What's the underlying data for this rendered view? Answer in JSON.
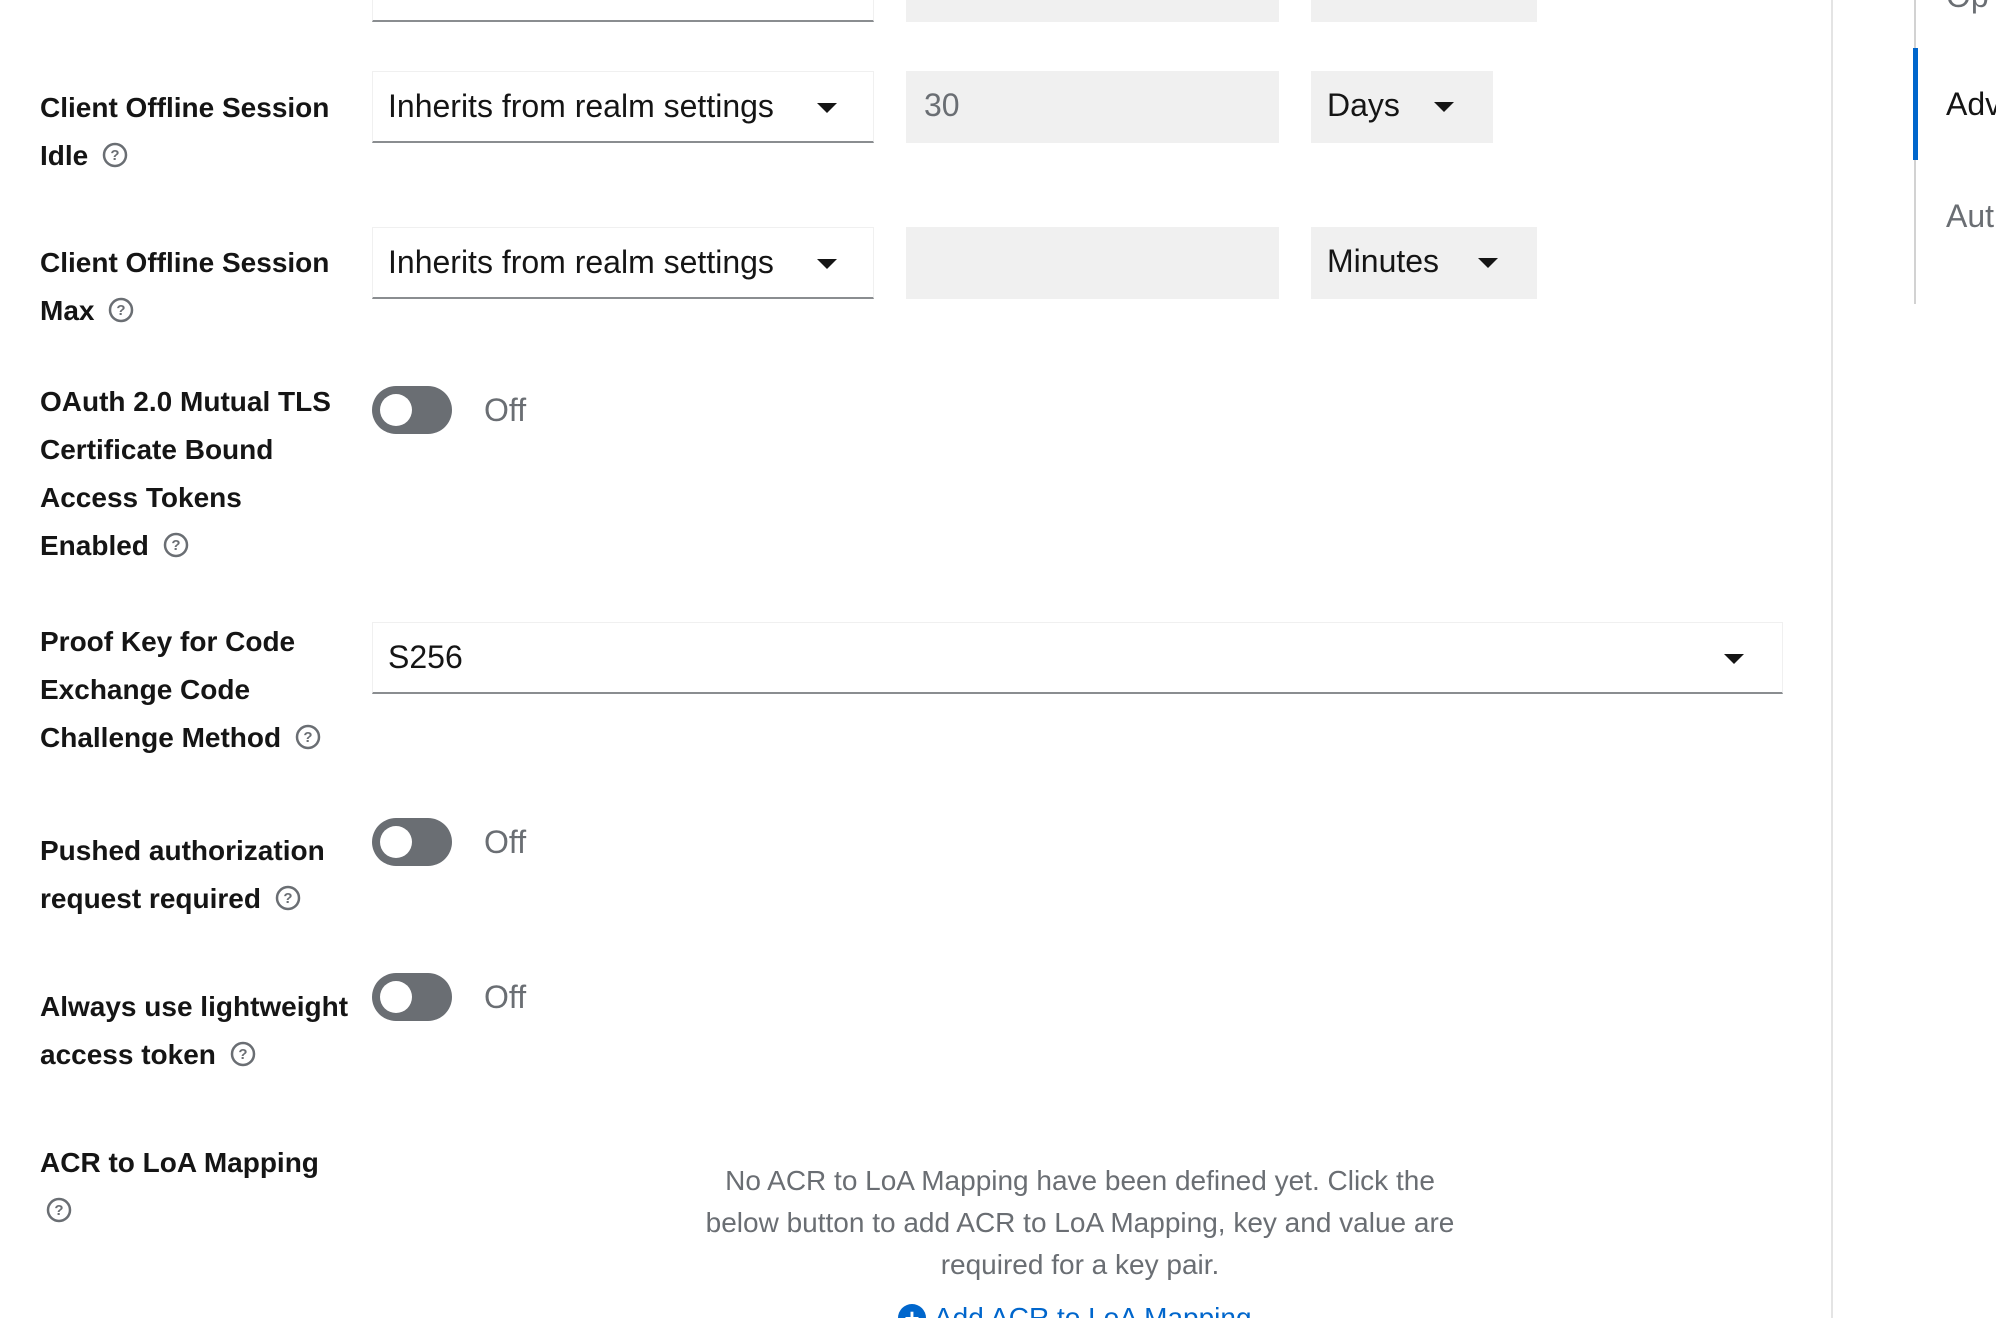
{
  "rows": {
    "offline_idle": {
      "label_line1": "Client Offline Session",
      "label_line2": "Idle",
      "select_value": "Inherits from realm settings",
      "number_value": "30",
      "unit_value": "Days"
    },
    "offline_max": {
      "label_line1": "Client Offline Session",
      "label_line2": "Max",
      "select_value": "Inherits from realm settings",
      "number_value": "",
      "unit_value": "Minutes"
    },
    "mtls": {
      "label_line1": "OAuth 2.0 Mutual TLS",
      "label_line2": "Certificate Bound",
      "label_line3": "Access Tokens",
      "label_line4": "Enabled",
      "state": "Off"
    },
    "pkce": {
      "label_line1": "Proof Key for Code",
      "label_line2": "Exchange Code",
      "label_line3": "Challenge Method",
      "select_value": "S256"
    },
    "par": {
      "label_line1": "Pushed authorization",
      "label_line2": "request required",
      "state": "Off"
    },
    "lightweight": {
      "label_line1": "Always use lightweight",
      "label_line2": "access token",
      "state": "Off"
    },
    "acr": {
      "label_line1": "ACR to LoA Mapping",
      "empty_message": "No ACR to LoA Mapping have been defined yet. Click the below button to add ACR to LoA Mapping, key and value are required for a key pair.",
      "add_label": "Add ACR to LoA Mapping"
    }
  },
  "jump_links": {
    "active_item": "Adv",
    "next_item": "Aut"
  },
  "colors": {
    "accent": "#0066cc",
    "switch_off": "#6a6e73",
    "field_bg": "#f0f0f0"
  }
}
